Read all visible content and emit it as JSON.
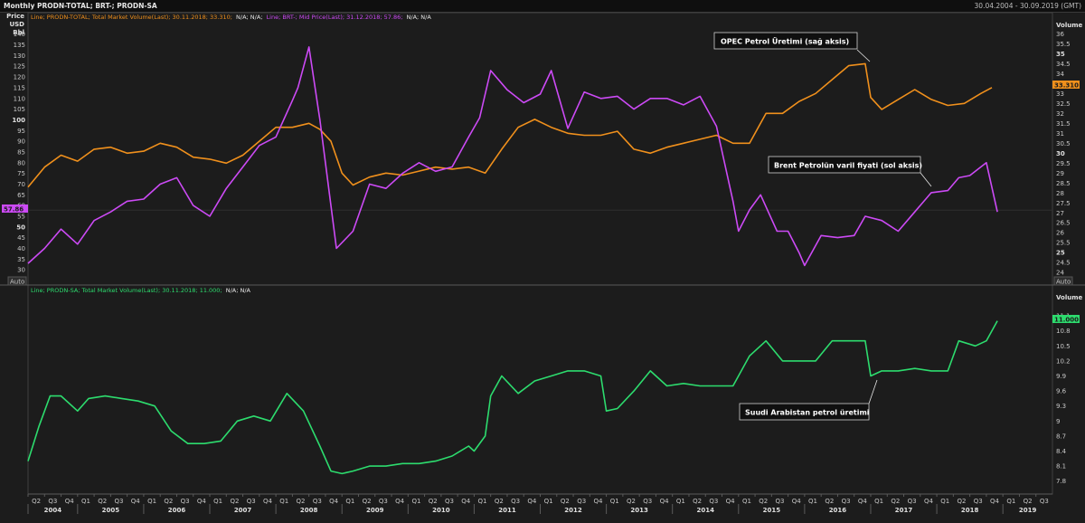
{
  "header": {
    "title": "Monthly PRODN-TOTAL; BRT-; PRODN-SA",
    "date_range": "30.04.2004 - 30.09.2019 (GMT)"
  },
  "legend_top": [
    {
      "text": "Line; PRODN-TOTAL; Total Market Volume(Last); 30.11.2018; 33.310;",
      "color": "#f0901c"
    },
    {
      "text": "N/A; N/A;",
      "color": "#e6e6e6"
    },
    {
      "text": "Line; BRT-; Mid Price(Last); 31.12.2018; 57.86;",
      "color": "#cc4af5"
    },
    {
      "text": "N/A; N/A",
      "color": "#e6e6e6"
    }
  ],
  "legend_bottom": [
    {
      "text": "Line; PRODN-SA; Total Market Volume(Last); 30.11.2018; 11.000;",
      "color": "#2ddc6e"
    },
    {
      "text": "N/A; N/A",
      "color": "#e6e6e6"
    }
  ],
  "axis_labels": {
    "left_title": [
      "Price",
      "USD",
      "Bbl"
    ],
    "right_title_top": "Volume",
    "right_title_bottom": "Volume",
    "auto": "Auto"
  },
  "badges": {
    "brent": "57.86",
    "opec": "33.310",
    "sa": "11.000"
  },
  "annotations": {
    "opec": "OPEC Petrol Üretimi (sağ aksis)",
    "brent": "Brent Petrolün varil fiyati (sol aksis)",
    "sa": "Suudi Arabistan petrol üretimi"
  },
  "colors": {
    "opec": "#f0901c",
    "brent": "#cc4af5",
    "sa": "#2ddc6e",
    "background": "#1c1c1c"
  },
  "chart_data": [
    {
      "type": "line",
      "title": "",
      "xlabel": "",
      "ylabel": "Price USD Bbl",
      "x_start": "2004-04",
      "x_end": "2019-09",
      "left_ticks": [
        30,
        35,
        40,
        45,
        50,
        55,
        60,
        65,
        70,
        75,
        80,
        85,
        90,
        95,
        100,
        105,
        110,
        115,
        120,
        125,
        130,
        135,
        140
      ],
      "left_ylim": [
        25,
        142
      ],
      "right_ticks": [
        24,
        24.5,
        25,
        25.5,
        26,
        26.5,
        27,
        27.5,
        28,
        28.5,
        29,
        29.5,
        30,
        30.5,
        31,
        31.5,
        32,
        32.5,
        33,
        33.5,
        34,
        34.5,
        35,
        35.5,
        36
      ],
      "right_ylim": [
        23.6,
        36.2
      ],
      "series": [
        {
          "name": "BRT-; Mid Price(Last)",
          "axis": "left",
          "x": [
            "2004-04",
            "2004-07",
            "2004-10",
            "2005-01",
            "2005-04",
            "2005-07",
            "2005-10",
            "2006-01",
            "2006-04",
            "2006-07",
            "2006-10",
            "2007-01",
            "2007-04",
            "2007-07",
            "2007-10",
            "2008-01",
            "2008-04",
            "2008-05",
            "2008-07",
            "2008-09",
            "2008-11",
            "2008-12",
            "2009-03",
            "2009-06",
            "2009-09",
            "2009-12",
            "2010-03",
            "2010-06",
            "2010-09",
            "2010-12",
            "2011-02",
            "2011-04",
            "2011-07",
            "2011-10",
            "2012-01",
            "2012-03",
            "2012-06",
            "2012-09",
            "2012-12",
            "2013-03",
            "2013-06",
            "2013-09",
            "2013-12",
            "2014-03",
            "2014-06",
            "2014-09",
            "2014-12",
            "2015-01",
            "2015-03",
            "2015-05",
            "2015-08",
            "2015-10",
            "2015-12",
            "2016-01",
            "2016-04",
            "2016-07",
            "2016-10",
            "2016-12",
            "2017-03",
            "2017-06",
            "2017-09",
            "2017-12",
            "2018-03",
            "2018-05",
            "2018-07",
            "2018-10",
            "2018-12"
          ],
          "values": [
            33,
            40,
            49,
            42,
            53,
            57,
            62,
            63,
            70,
            73,
            60,
            55,
            68,
            78,
            88,
            92,
            109,
            115,
            134,
            100,
            60,
            40,
            48,
            70,
            68,
            75,
            80,
            76,
            78,
            92,
            101,
            123,
            114,
            108,
            112,
            123,
            96,
            113,
            110,
            111,
            105,
            110,
            110,
            107,
            111,
            97,
            62,
            48,
            58,
            65,
            48,
            48,
            38,
            32,
            46,
            45,
            46,
            55,
            53,
            48,
            57,
            66,
            67,
            73,
            74,
            80,
            57
          ]
        },
        {
          "name": "PRODN-TOTAL; Total Market Volume(Last)",
          "axis": "right",
          "x": [
            "2004-04",
            "2004-07",
            "2004-10",
            "2005-01",
            "2005-04",
            "2005-07",
            "2005-10",
            "2006-01",
            "2006-04",
            "2006-07",
            "2006-10",
            "2007-01",
            "2007-04",
            "2007-07",
            "2007-10",
            "2008-01",
            "2008-04",
            "2008-07",
            "2008-09",
            "2008-11",
            "2009-01",
            "2009-03",
            "2009-06",
            "2009-09",
            "2009-12",
            "2010-03",
            "2010-06",
            "2010-09",
            "2010-12",
            "2011-03",
            "2011-06",
            "2011-09",
            "2011-12",
            "2012-03",
            "2012-06",
            "2012-09",
            "2012-12",
            "2013-03",
            "2013-06",
            "2013-09",
            "2013-12",
            "2014-03",
            "2014-06",
            "2014-09",
            "2014-12",
            "2015-03",
            "2015-06",
            "2015-09",
            "2015-12",
            "2016-03",
            "2016-06",
            "2016-09",
            "2016-12",
            "2017-01",
            "2017-03",
            "2017-06",
            "2017-09",
            "2017-12",
            "2018-03",
            "2018-06",
            "2018-09",
            "2018-11"
          ],
          "values": [
            28.3,
            29.3,
            29.9,
            29.6,
            30.2,
            30.3,
            30.0,
            30.1,
            30.5,
            30.3,
            29.8,
            29.7,
            29.5,
            29.9,
            30.6,
            31.3,
            31.3,
            31.5,
            31.2,
            30.6,
            29.0,
            28.4,
            28.8,
            29.0,
            28.9,
            29.1,
            29.3,
            29.2,
            29.3,
            29.0,
            30.2,
            31.3,
            31.7,
            31.3,
            31.0,
            30.9,
            30.9,
            31.1,
            30.2,
            30.0,
            30.3,
            30.5,
            30.7,
            30.9,
            30.5,
            30.5,
            32.0,
            32.0,
            32.6,
            33.0,
            33.7,
            34.4,
            34.5,
            32.8,
            32.2,
            32.7,
            33.2,
            32.7,
            32.4,
            32.5,
            33.0,
            33.3
          ]
        }
      ]
    },
    {
      "type": "line",
      "title": "",
      "xlabel": "",
      "ylabel": "",
      "x_start": "2004-04",
      "x_end": "2019-09",
      "right_ticks": [
        7.8,
        8.1,
        8.4,
        8.7,
        9,
        9.3,
        9.6,
        9.9,
        10.2,
        10.5,
        10.8,
        11.1
      ],
      "right_ylim": [
        7.65,
        11.3
      ],
      "x_quarters": [
        "Q2",
        "Q3",
        "Q4",
        "Q1",
        "Q2",
        "Q3",
        "Q4",
        "Q1",
        "Q2",
        "Q3",
        "Q4",
        "Q1",
        "Q2",
        "Q3",
        "Q4",
        "Q1",
        "Q2",
        "Q3",
        "Q4",
        "Q1",
        "Q2",
        "Q3",
        "Q4",
        "Q1",
        "Q2",
        "Q3",
        "Q4",
        "Q1",
        "Q2",
        "Q3",
        "Q4",
        "Q1",
        "Q2",
        "Q3",
        "Q4",
        "Q1",
        "Q2",
        "Q3",
        "Q4",
        "Q1",
        "Q2",
        "Q3",
        "Q4",
        "Q1",
        "Q2",
        "Q3",
        "Q4",
        "Q1",
        "Q2",
        "Q3",
        "Q4",
        "Q1",
        "Q2",
        "Q3",
        "Q4",
        "Q1",
        "Q2",
        "Q3",
        "Q4",
        "Q1",
        "Q2",
        "Q3"
      ],
      "x_years": [
        "2004",
        "2005",
        "2006",
        "2007",
        "2008",
        "2009",
        "2010",
        "2011",
        "2012",
        "2013",
        "2014",
        "2015",
        "2016",
        "2017",
        "2018",
        "2019"
      ],
      "series": [
        {
          "name": "PRODN-SA; Total Market Volume(Last)",
          "axis": "right",
          "x": [
            "2004-04",
            "2004-06",
            "2004-08",
            "2004-10",
            "2005-01",
            "2005-03",
            "2005-06",
            "2005-09",
            "2005-12",
            "2006-03",
            "2006-06",
            "2006-09",
            "2006-12",
            "2007-03",
            "2007-06",
            "2007-09",
            "2007-12",
            "2008-03",
            "2008-06",
            "2008-09",
            "2008-11",
            "2009-01",
            "2009-03",
            "2009-06",
            "2009-09",
            "2009-12",
            "2010-03",
            "2010-06",
            "2010-09",
            "2010-12",
            "2011-01",
            "2011-03",
            "2011-04",
            "2011-06",
            "2011-09",
            "2011-12",
            "2012-03",
            "2012-06",
            "2012-09",
            "2012-12",
            "2013-01",
            "2013-03",
            "2013-06",
            "2013-09",
            "2013-12",
            "2014-03",
            "2014-06",
            "2014-09",
            "2014-12",
            "2015-03",
            "2015-06",
            "2015-09",
            "2015-12",
            "2016-03",
            "2016-06",
            "2016-09",
            "2016-12",
            "2017-01",
            "2017-03",
            "2017-06",
            "2017-09",
            "2017-12",
            "2018-03",
            "2018-05",
            "2018-08",
            "2018-10",
            "2018-12"
          ],
          "values": [
            8.2,
            8.9,
            9.5,
            9.5,
            9.2,
            9.45,
            9.5,
            9.45,
            9.4,
            9.3,
            8.8,
            8.55,
            8.55,
            8.6,
            9.0,
            9.1,
            9.0,
            9.55,
            9.2,
            8.5,
            8.0,
            7.95,
            8.0,
            8.1,
            8.1,
            8.15,
            8.15,
            8.2,
            8.3,
            8.5,
            8.4,
            8.7,
            9.5,
            9.9,
            9.55,
            9.8,
            9.9,
            10.0,
            10.0,
            9.9,
            9.2,
            9.25,
            9.6,
            10.0,
            9.7,
            9.75,
            9.7,
            9.7,
            9.7,
            10.3,
            10.6,
            10.2,
            10.2,
            10.2,
            10.6,
            10.6,
            10.6,
            9.9,
            10.0,
            10.0,
            10.05,
            10.0,
            10.0,
            10.6,
            10.5,
            10.6,
            11.0
          ]
        }
      ]
    }
  ]
}
